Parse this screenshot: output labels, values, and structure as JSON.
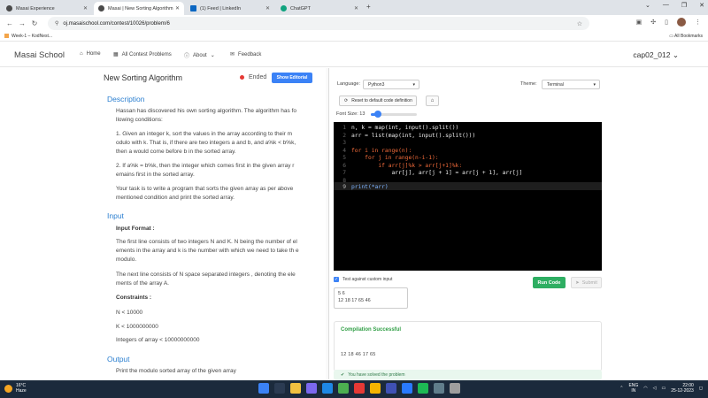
{
  "browser": {
    "tabs": [
      {
        "label": "Masai Experience",
        "icon": "masai-icon",
        "color": "#4a4a4a"
      },
      {
        "label": "Masai | New Sorting Algorithm",
        "icon": "masai-icon",
        "color": "#4a4a4a"
      },
      {
        "label": "(1) Feed | LinkedIn",
        "icon": "linkedin-icon",
        "color": "#0a66c2"
      },
      {
        "label": "ChatGPT",
        "icon": "chatgpt-icon",
        "color": "#10a37f"
      }
    ],
    "url": "oj.masaischool.com/contest/10026/problem/6",
    "bookmark_left": "Week-1 – KodNest...",
    "bookmark_right": "All Bookmarks"
  },
  "site": {
    "logo": "Masai School",
    "nav": {
      "home": "Home",
      "contests": "All Contest Problems",
      "about": "About",
      "feedback": "Feedback"
    },
    "user": "cap02_012"
  },
  "problem": {
    "title": "New Sorting Algorithm",
    "status": "Ended",
    "editorial_button": "Show Editorial",
    "description_heading": "Description",
    "description": [
      "Hassan has discovered his own sorting algorithm. The algorithm has fo llowing conditions:",
      "1. Given an integer k, sort the values in the array according to their m odulo with k. That is, if there are two integers a and b, and a%k < b%k, then a would come before b in the sorted array.",
      "2. If a%k = b%k, then the integer which comes first in the given array r emains first in the sorted array.",
      "Your task is to write a program that sorts the given array as per above mentioned condition and print the sorted array."
    ],
    "input_heading": "Input",
    "input_format_label": "Input Format :",
    "input_format": [
      "The first line consists of two integers N and K. N being the number of el ements in the array and k is the number with which we need to take th e modulo.",
      "The next line consists of N space separated integers , denoting the ele ments of the array A."
    ],
    "constraints_label": "Constraints :",
    "constraints": [
      "N < 10000",
      "K < 1000000000",
      "Integers of array < 10000000000"
    ],
    "output_heading": "Output",
    "output_text": "Print the modulo sorted array of the given array"
  },
  "editor": {
    "language_label": "Language:",
    "language": "Python3",
    "theme_label": "Theme:",
    "theme": "Terminal",
    "reset_label": "Reset to default code definition",
    "font_size_label": "Font Size:",
    "font_size": "13",
    "font_slider_fraction": 0.15,
    "lines": [
      {
        "n": "1",
        "text": "n, k = map(int, input().split())"
      },
      {
        "n": "2",
        "text": "arr = list(map(int, input().split()))"
      },
      {
        "n": "3",
        "text": ""
      },
      {
        "n": "4",
        "text": "for i in range(n):"
      },
      {
        "n": "5",
        "text": "    for j in range(n-i-1):"
      },
      {
        "n": "6",
        "text": "        if arr[j]%k > arr[j+1]%k:"
      },
      {
        "n": "7",
        "text": "            arr[j], arr[j + 1] = arr[j + 1], arr[j]"
      },
      {
        "n": "8",
        "text": ""
      },
      {
        "n": "9",
        "text": "print(*arr)"
      }
    ],
    "custom_input_label": "Test against custom input",
    "custom_input": [
      "5 6",
      "12 18 17 65 46"
    ],
    "run_label": "Run Code",
    "submit_label": "Submit",
    "compilation_title": "Compilation Successful",
    "compilation_output": "12 18 46 17 65",
    "solved_message": "You have solved the problem"
  },
  "taskbar": {
    "temperature": "16°C",
    "weather": "Haze",
    "language": "ENG",
    "region": "IN",
    "time": "22:00",
    "date": "25-12-2023"
  },
  "colors": {
    "accent": "#3b82f6",
    "run": "#2eae62",
    "success": "#2f9e44",
    "ended_dot": "#e53935"
  }
}
